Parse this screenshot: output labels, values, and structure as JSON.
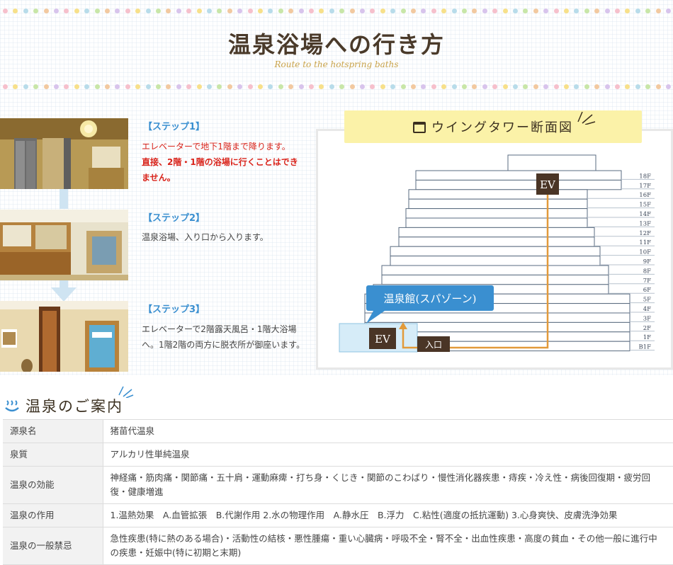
{
  "header": {
    "title": "温泉浴場への行き方",
    "subtitle": "Route to the hotspring baths"
  },
  "steps": [
    {
      "label": "【ステップ1】",
      "text_red": "エレベーターで地下1階まで降ります。",
      "text_red_bold": "直接、2階・1階の浴場に行くことはできません。"
    },
    {
      "label": "【ステップ2】",
      "text": "温泉浴場、入り口から入ります。"
    },
    {
      "label": "【ステップ3】",
      "text": "エレベーターで2階露天風呂・1階大浴場へ。1階2階の両方に脱衣所が御座います。"
    }
  ],
  "diagram": {
    "title": "ウイングタワー断面図",
    "floors": [
      "18F",
      "17F",
      "16F",
      "15F",
      "14F",
      "13F",
      "12F",
      "11F",
      "10F",
      "9F",
      "8F",
      "7F",
      "6F",
      "5F",
      "4F",
      "3F",
      "2F",
      "1F",
      "B1F"
    ],
    "ev_top_label": "EV",
    "ev_bottom_label": "EV",
    "entrance_label": "入口",
    "callout": "温泉館(スパゾーン)",
    "route_color": "#e29a3a",
    "callout_color": "#3a8fd0"
  },
  "info": {
    "heading": "温泉のご案内",
    "rows": [
      {
        "label": "源泉名",
        "value": "猪苗代温泉"
      },
      {
        "label": "泉質",
        "value": "アルカリ性単純温泉"
      },
      {
        "label": "温泉の効能",
        "value": "神経痛・筋肉痛・関節痛・五十肩・運動麻痺・打ち身・くじき・関節のこわばり・慢性消化器疾患・痔疾・冷え性・病後回復期・疲労回復・健康増進"
      },
      {
        "label": "温泉の作用",
        "value": "1.温熱効果　A.血管拡張　B.代謝作用 2.水の物理作用　A.静水圧　B.浮力　C.粘性(適度の抵抗運動) 3.心身爽快、皮膚洗浄効果"
      },
      {
        "label": "温泉の一般禁忌",
        "value": "急性疾患(特に熱のある場合)・活動性の結核・悪性腫瘍・重い心臓病・呼吸不全・腎不全・出血性疾患・高度の貧血・その他一般に進行中の疾患・妊娠中(特に初期と末期)"
      }
    ]
  }
}
